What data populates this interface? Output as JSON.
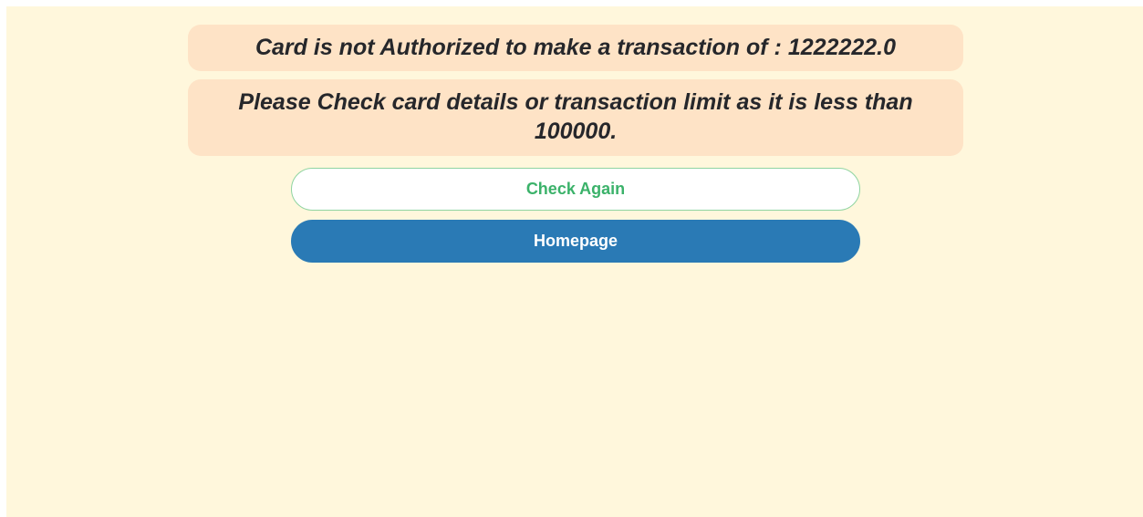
{
  "messages": {
    "error": "Card is not Authorized to make a transaction of : 1222222.0",
    "hint": "Please Check card details or transaction limit as it is less than 100000."
  },
  "actions": {
    "check_again_label": "Check Again",
    "homepage_label": "Homepage"
  },
  "colors": {
    "background": "#fff7dc",
    "banner": "#fee3c6",
    "check_again_text": "#3bb26a",
    "check_again_border": "#8fd4a0",
    "homepage_button": "#2a7ab5"
  }
}
